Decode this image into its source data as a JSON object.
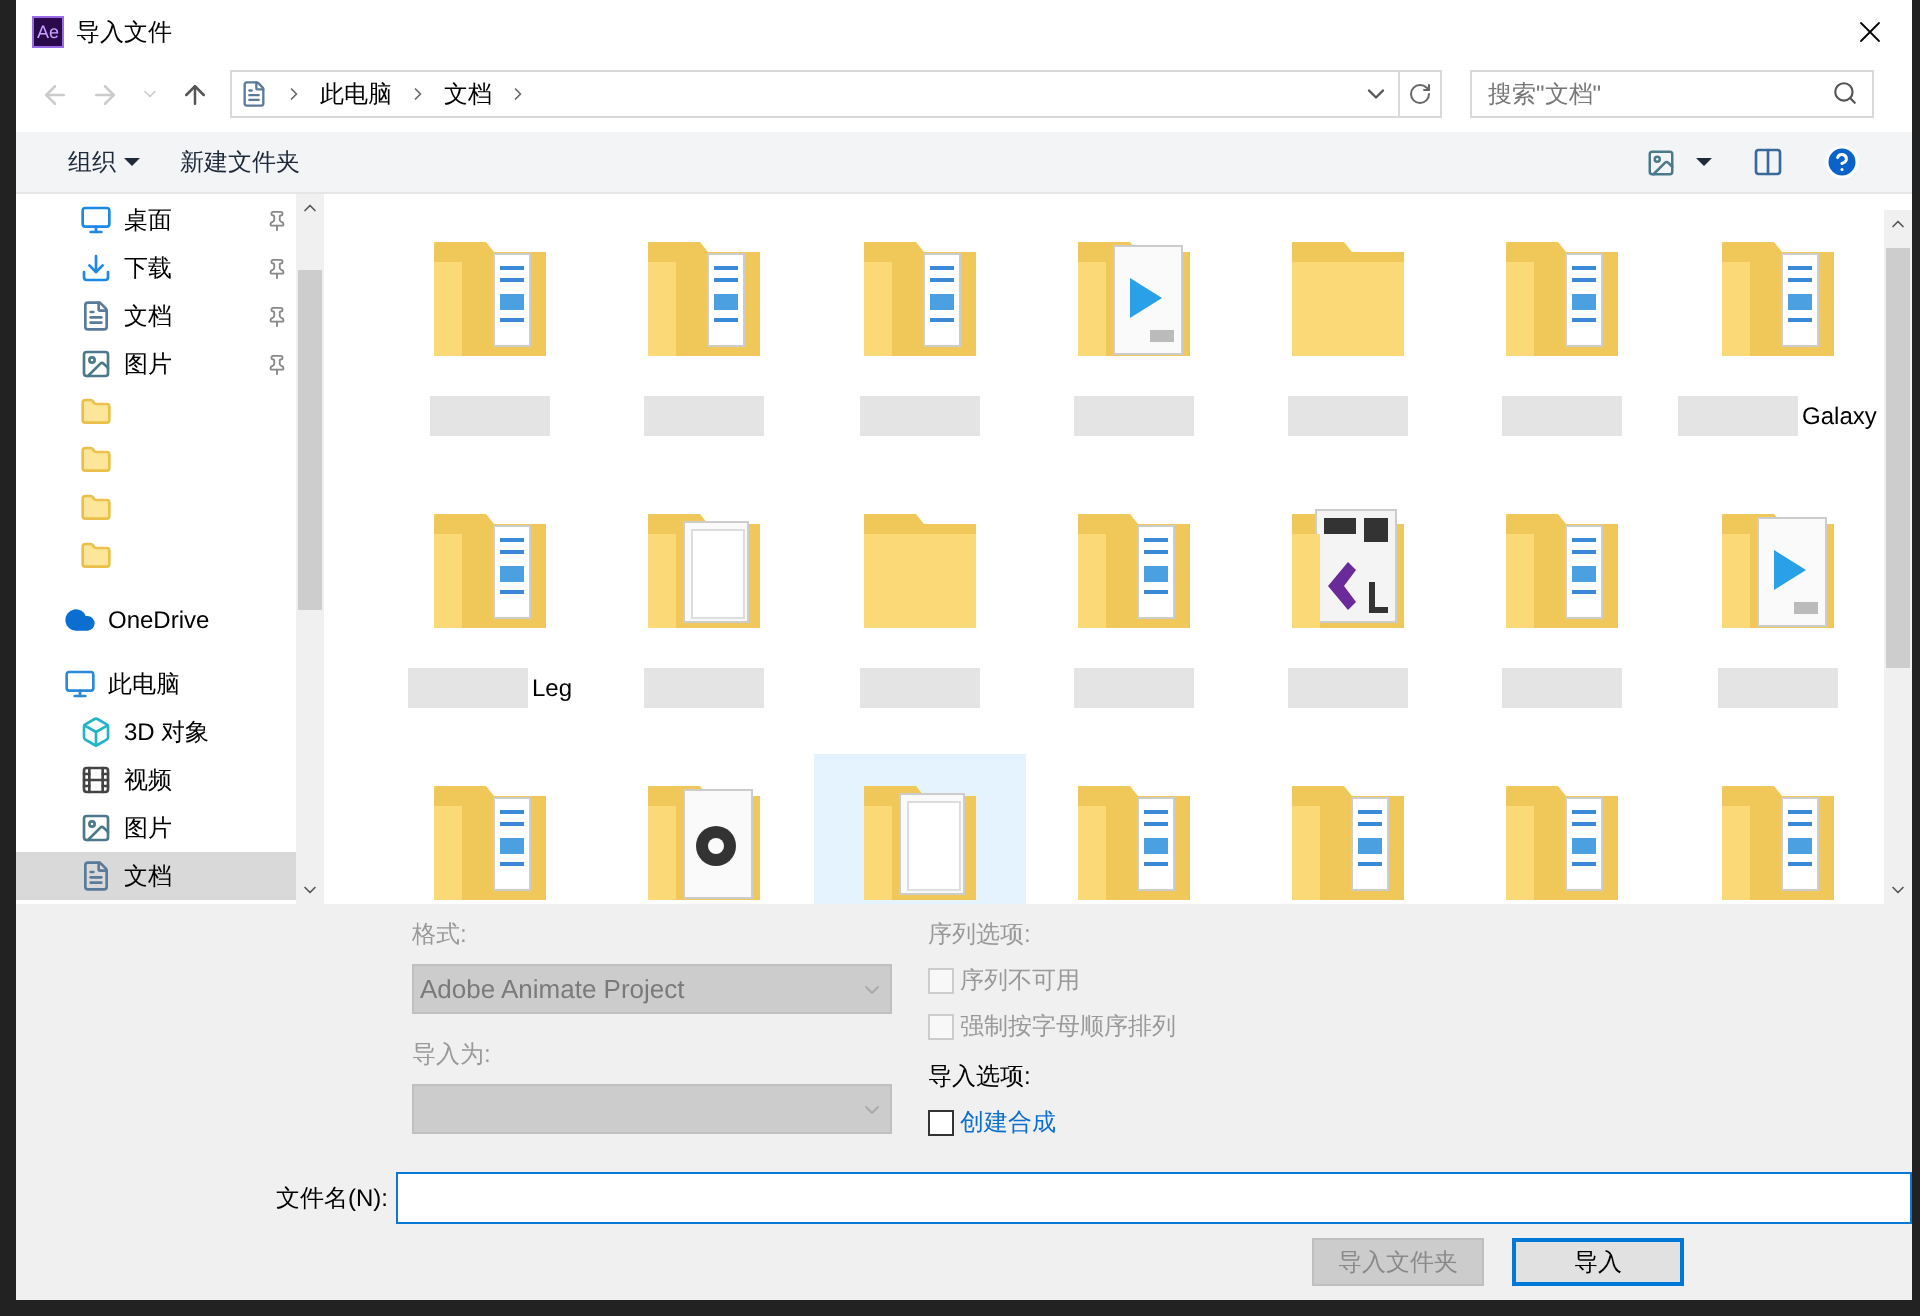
{
  "window": {
    "title": "导入文件",
    "app_badge": "Ae"
  },
  "address": {
    "path": [
      "此电脑",
      "文档"
    ],
    "search_placeholder": "搜索\"文档\""
  },
  "toolbar": {
    "organize": "组织",
    "new_folder": "新建文件夹"
  },
  "sidebar": [
    {
      "label": "桌面",
      "kind": "desktop",
      "pinned": true,
      "selected": false
    },
    {
      "label": "下载",
      "kind": "download",
      "pinned": true,
      "selected": false
    },
    {
      "label": "文档",
      "kind": "document",
      "pinned": true,
      "selected": false
    },
    {
      "label": "图片",
      "kind": "picture",
      "pinned": true,
      "selected": false
    },
    {
      "kind": "folder",
      "pinned": false,
      "selected": false
    },
    {
      "kind": "folder",
      "pinned": false,
      "selected": false
    },
    {
      "kind": "folder",
      "pinned": false,
      "selected": false
    },
    {
      "kind": "folder",
      "pinned": false,
      "selected": false
    },
    {
      "label": "OneDrive",
      "kind": "cloud",
      "pinned": false,
      "selected": false
    },
    {
      "label": "此电脑",
      "kind": "computer",
      "pinned": false,
      "selected": false
    },
    {
      "label": "3D 对象",
      "kind": "cube",
      "pinned": false,
      "selected": false
    },
    {
      "label": "视频",
      "kind": "film",
      "pinned": false,
      "selected": false
    },
    {
      "label": "图片",
      "kind": "picture",
      "pinned": false,
      "selected": false
    },
    {
      "label": "文档",
      "kind": "document",
      "pinned": false,
      "selected": true
    }
  ],
  "files": [
    {
      "kind": "docs",
      "blurred": true,
      "selected": false
    },
    {
      "kind": "docs",
      "blurred": true,
      "selected": false
    },
    {
      "kind": "docs",
      "blurred": true,
      "selected": false
    },
    {
      "kind": "vcd",
      "blurred": true,
      "selected": false
    },
    {
      "kind": "plain",
      "blurred": true,
      "selected": false
    },
    {
      "kind": "docs",
      "blurred": true,
      "selected": false
    },
    {
      "kind": "docs",
      "label": "Galaxy",
      "blurred": true,
      "selected": false
    },
    {
      "kind": "docs",
      "label": "Leg",
      "blurred": true,
      "selected": false
    },
    {
      "kind": "paper",
      "blurred": true,
      "selected": false
    },
    {
      "kind": "plain",
      "blurred": true,
      "selected": false
    },
    {
      "kind": "docs",
      "blurred": true,
      "selected": false
    },
    {
      "kind": "vs",
      "blurred": true,
      "selected": false
    },
    {
      "kind": "docs",
      "blurred": true,
      "selected": false
    },
    {
      "kind": "vcd",
      "blurred": true,
      "selected": false
    },
    {
      "kind": "docs",
      "selected": false
    },
    {
      "kind": "gear",
      "selected": false
    },
    {
      "kind": "paper",
      "selected": true
    },
    {
      "kind": "docs",
      "selected": false
    },
    {
      "kind": "docs",
      "selected": false
    },
    {
      "kind": "docs",
      "selected": false
    },
    {
      "kind": "docs",
      "selected": false
    }
  ],
  "options": {
    "format_label": "格式:",
    "format_value": "Adobe Animate Project",
    "import_as_label": "导入为:",
    "sequence_label": "序列选项:",
    "sequence_checks": [
      {
        "label": "序列不可用",
        "checked": false,
        "disabled": true
      },
      {
        "label": "强制按字母顺序排列",
        "checked": false,
        "disabled": true
      }
    ],
    "import_label": "导入选项:",
    "import_checks": [
      {
        "label": "创建合成",
        "checked": false,
        "disabled": false
      }
    ]
  },
  "filename": {
    "label": "文件名(N):"
  },
  "buttons": [
    {
      "label": "导入文件夹",
      "disabled": true,
      "default": false
    },
    {
      "label": "导入",
      "disabled": false,
      "default": true
    }
  ]
}
